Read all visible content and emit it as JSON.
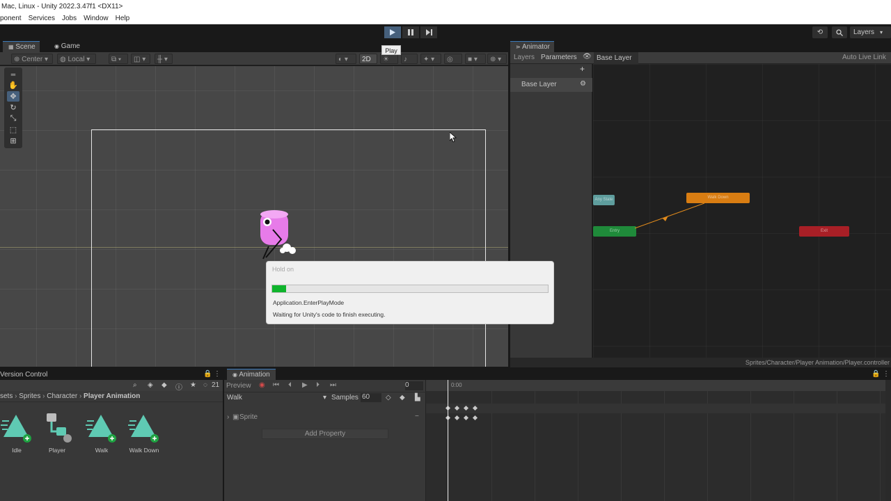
{
  "window": {
    "title": "Mac, Linux - Unity 2022.3.47f1 <DX11>",
    "menu": [
      "ponent",
      "Services",
      "Jobs",
      "Window",
      "Help"
    ]
  },
  "toolbar": {
    "play_tooltip": "Play",
    "layers_label": "Layers"
  },
  "scene": {
    "tabs": [
      "Scene",
      "Game"
    ],
    "pivot_mode": "Center",
    "pivot_rotation": "Local",
    "mode_2d": "2D"
  },
  "dialog": {
    "title": "Hold on",
    "progress": 0.05,
    "line1": "Application.EnterPlayMode",
    "line2": "Waiting for Unity's code to finish executing."
  },
  "animator": {
    "tab": "Animator",
    "subtabs": [
      "Layers",
      "Parameters"
    ],
    "breadcrumb": "Base Layer",
    "auto_live_link": "Auto Live Link",
    "layer_name": "Base Layer",
    "footer_path": "Sprites/Character/Player Animation/Player.controller",
    "nodes": {
      "any_state": "Any State",
      "entry": "Entry",
      "walk_down": "Walk Down",
      "exit": "Exit"
    },
    "node_colors": {
      "any_state": "#5e9d9d",
      "entry": "#1f8a3a",
      "walk_down": "#d97d12",
      "exit": "#a81f26"
    }
  },
  "project": {
    "tab": "Version Control",
    "hidden_count": "21",
    "breadcrumb": [
      "sets",
      "Sprites",
      "Character",
      "Player Animation"
    ],
    "assets": [
      "Idle",
      "Player",
      "Walk",
      "Walk Down"
    ]
  },
  "animation": {
    "tab": "Animation",
    "preview": "Preview",
    "frame": "0",
    "clip": "Walk",
    "samples_label": "Samples",
    "samples_value": "60",
    "property": "Sprite",
    "add_property": "Add Property",
    "ruler_start": "0:00"
  }
}
